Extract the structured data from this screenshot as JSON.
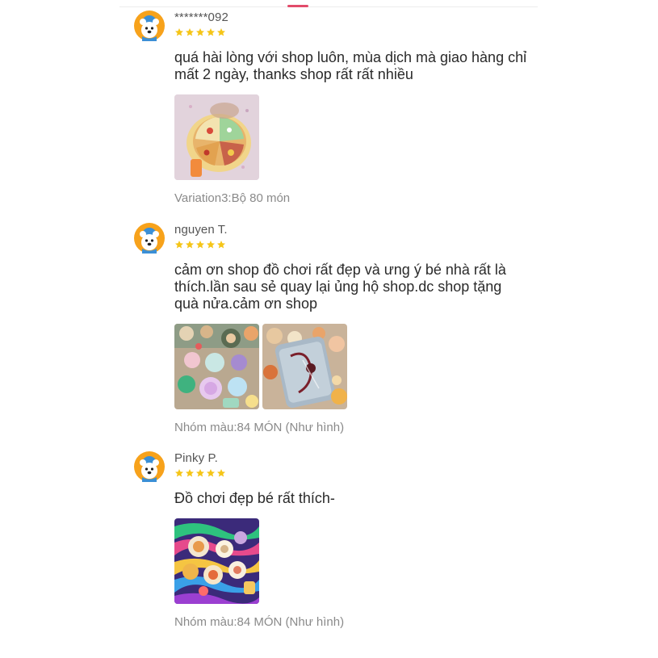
{
  "reviews": [
    {
      "username": "*******092",
      "rating": 5,
      "text": "quá hài lòng với shop luôn, mùa dịch mà giao hàng chỉ mất 2 ngày, thanks shop rất rất nhiều",
      "photos": [
        "pizza-toy-photo"
      ],
      "variation": "Variation3:Bộ 80 món"
    },
    {
      "username": "nguyen T.",
      "rating": 5,
      "text": "cảm ơn shop đồ chơi rất đẹp và ưng ý bé nhà rất là thích.lần sau sẻ quay lại ủng hộ shop.dc shop tặng quà nửa.cảm ơn shop",
      "photos": [
        "toy-food-set-photo",
        "gift-package-photo"
      ],
      "variation": "Nhóm màu:84 MÓN (Như hình)"
    },
    {
      "username": "Pinky P.",
      "rating": 5,
      "text": "Đồ chơi đẹp bé rất thích-",
      "photos": [
        "toy-food-on-blanket-photo"
      ],
      "variation": "Nhóm màu:84 MÓN (Như hình)"
    }
  ],
  "colors": {
    "star": "#f5c518",
    "accent": "#e24b6a",
    "avatar_bg": "#f7a21b"
  }
}
